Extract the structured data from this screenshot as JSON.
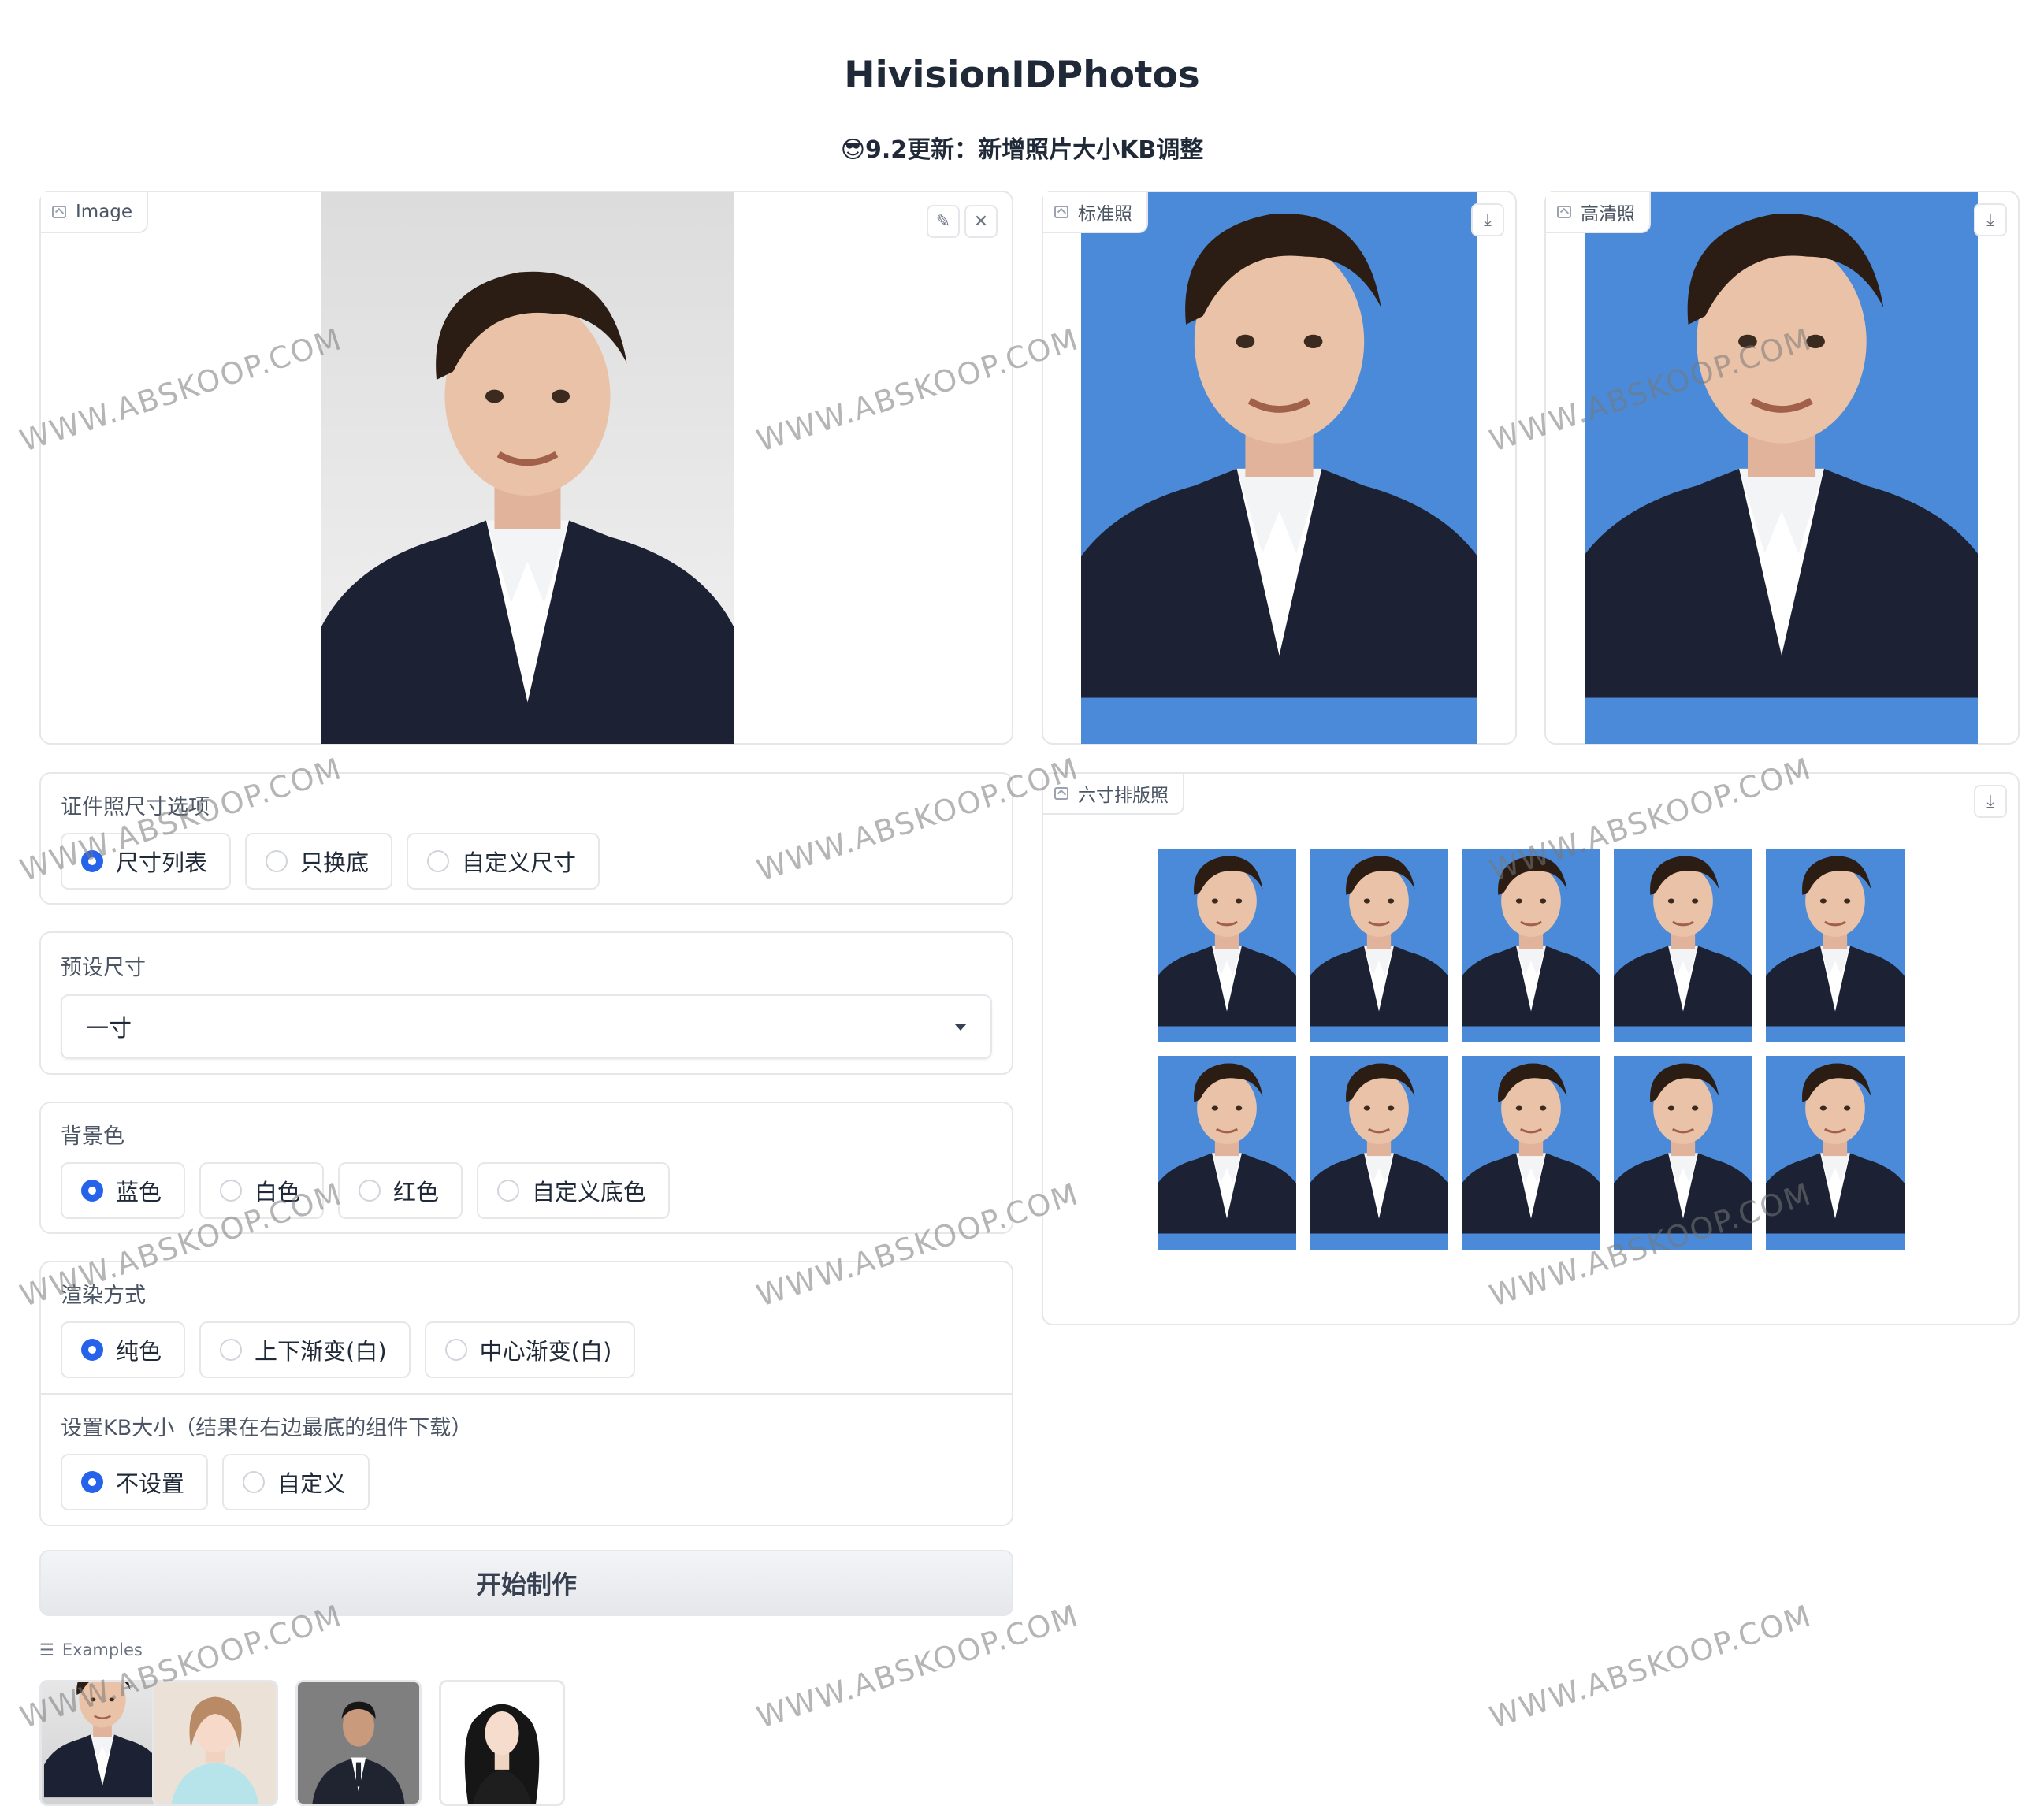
{
  "header": {
    "title": "HivisionIDPhotos",
    "subtitle": "😎9.2更新：新增照片大小KB调整"
  },
  "input_image": {
    "label": "Image"
  },
  "outputs": {
    "standard_label": "标准照",
    "hd_label": "高清照",
    "layout_label": "六寸排版照"
  },
  "size_options": {
    "label": "证件照尺寸选项",
    "options": [
      "尺寸列表",
      "只换底",
      "自定义尺寸"
    ],
    "selected": 0
  },
  "preset_size": {
    "label": "预设尺寸",
    "value": "一寸"
  },
  "background_color": {
    "label": "背景色",
    "options": [
      "蓝色",
      "白色",
      "红色",
      "自定义底色"
    ],
    "selected": 0
  },
  "render_mode": {
    "label": "渲染方式",
    "options": [
      "纯色",
      "上下渐变(白)",
      "中心渐变(白)"
    ],
    "selected": 0
  },
  "kb_size": {
    "label": "设置KB大小（结果在右边最底的组件下载）",
    "options": [
      "不设置",
      "自定义"
    ],
    "selected": 0
  },
  "start_button": "开始制作",
  "examples": {
    "label": "Examples"
  },
  "watermark_text": "WWW.ABSKOOP.COM",
  "colors": {
    "accent": "#2563eb",
    "photo_blue": "#4b8ad8",
    "border": "#e5e7eb"
  }
}
